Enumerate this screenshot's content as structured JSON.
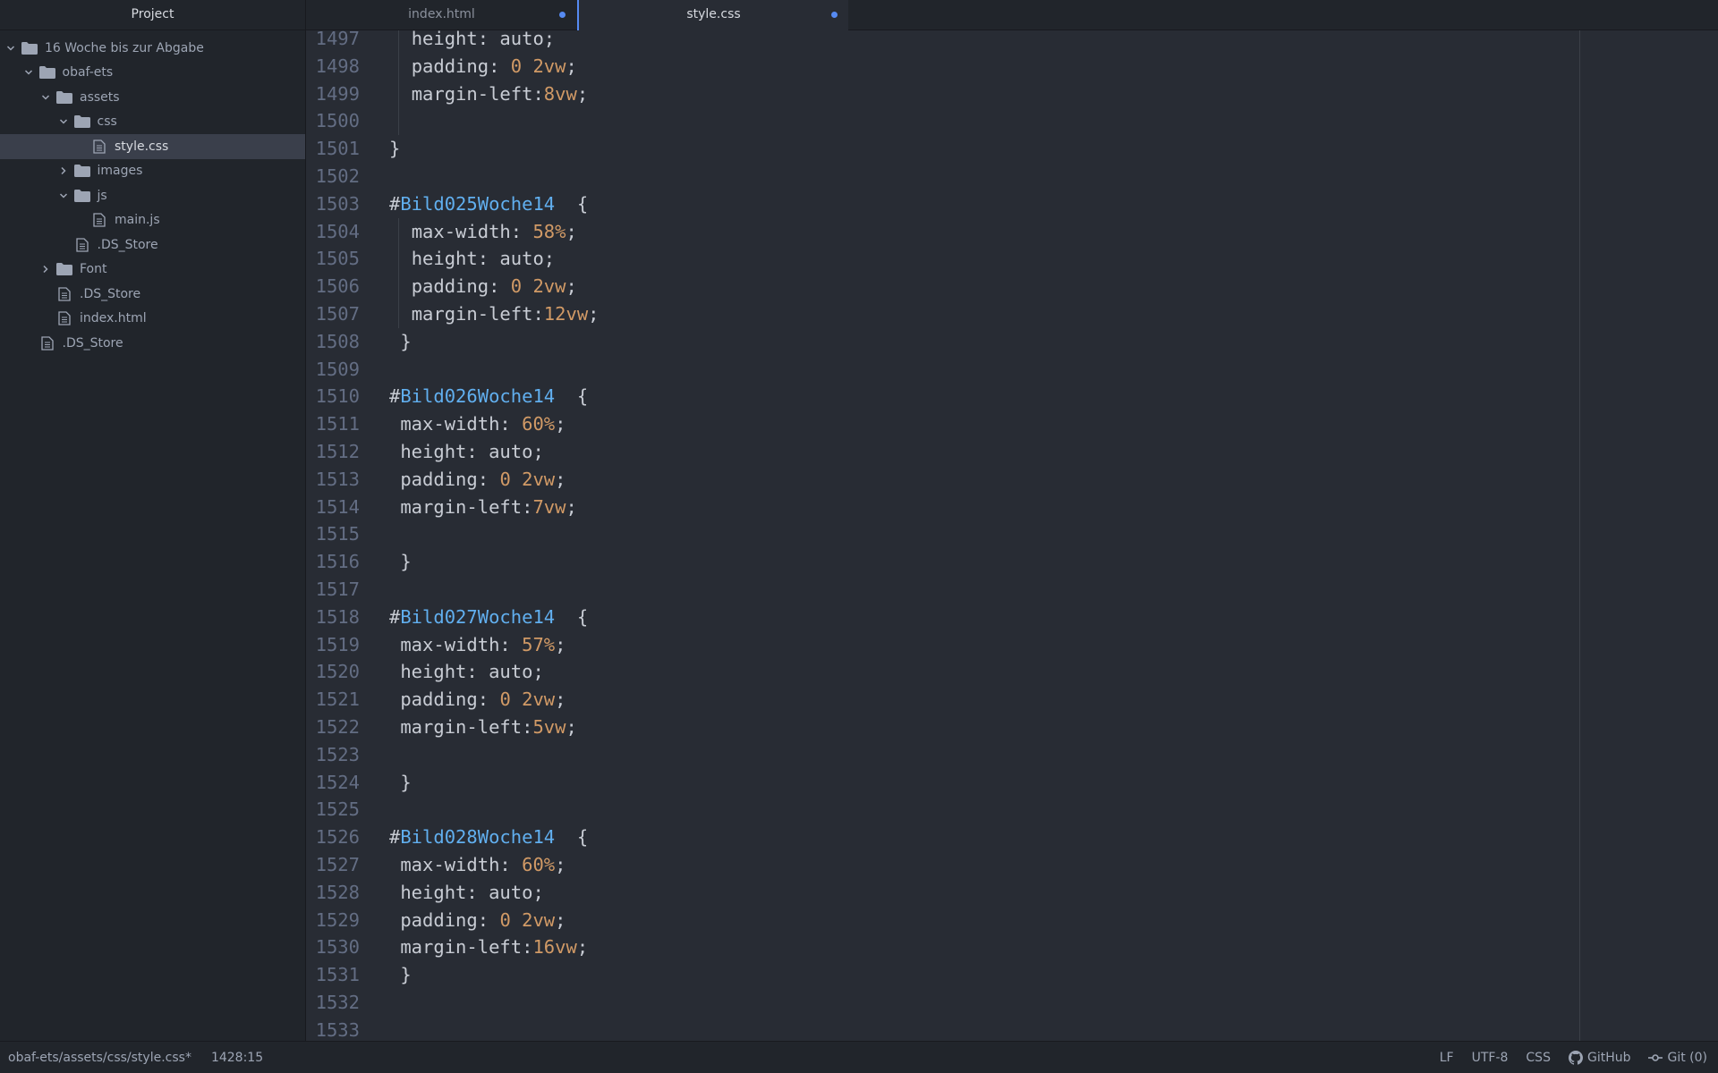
{
  "sidebar": {
    "title": "Project",
    "tree": [
      {
        "label": "16 Woche bis zur Abgabe",
        "type": "folder",
        "expanded": true,
        "depth": 0
      },
      {
        "label": "obaf-ets",
        "type": "folder",
        "expanded": true,
        "depth": 1
      },
      {
        "label": "assets",
        "type": "folder",
        "expanded": true,
        "depth": 2
      },
      {
        "label": "css",
        "type": "folder",
        "expanded": true,
        "depth": 3
      },
      {
        "label": "style.css",
        "type": "file",
        "depth": 4,
        "selected": true
      },
      {
        "label": "images",
        "type": "folder",
        "expanded": false,
        "depth": 3
      },
      {
        "label": "js",
        "type": "folder",
        "expanded": true,
        "depth": 3
      },
      {
        "label": "main.js",
        "type": "file",
        "depth": 4
      },
      {
        "label": ".DS_Store",
        "type": "file",
        "depth": 3
      },
      {
        "label": "Font",
        "type": "folder",
        "expanded": false,
        "depth": 2
      },
      {
        "label": ".DS_Store",
        "type": "file",
        "depth": 2
      },
      {
        "label": "index.html",
        "type": "file",
        "depth": 2
      },
      {
        "label": ".DS_Store",
        "type": "file",
        "depth": 1
      }
    ]
  },
  "tabs": [
    {
      "label": "index.html",
      "active": false,
      "modified": true
    },
    {
      "label": "style.css",
      "active": true,
      "modified": true
    }
  ],
  "editor": {
    "lines": [
      {
        "n": "1497",
        "indent": "  ",
        "parts": [
          [
            "p",
            "height: auto;"
          ]
        ],
        "guide": true
      },
      {
        "n": "1498",
        "indent": "  ",
        "parts": [
          [
            "p",
            "padding: "
          ],
          [
            "n",
            "0 2vw"
          ],
          [
            "p",
            ";"
          ]
        ],
        "guide": true
      },
      {
        "n": "1499",
        "indent": "  ",
        "parts": [
          [
            "p",
            "margin-left:"
          ],
          [
            "n",
            "8vw"
          ],
          [
            "p",
            ";"
          ]
        ],
        "guide": true
      },
      {
        "n": "1500",
        "indent": "",
        "parts": [],
        "guide": true
      },
      {
        "n": "1501",
        "indent": "",
        "parts": [
          [
            "p",
            "}"
          ]
        ]
      },
      {
        "n": "1502",
        "indent": "",
        "parts": []
      },
      {
        "n": "1503",
        "indent": "",
        "parts": [
          [
            "h",
            "#"
          ],
          [
            "i",
            "Bild025Woche14"
          ],
          [
            "p",
            "  {"
          ]
        ]
      },
      {
        "n": "1504",
        "indent": "  ",
        "parts": [
          [
            "p",
            "max-width: "
          ],
          [
            "n",
            "58%"
          ],
          [
            "p",
            ";"
          ]
        ],
        "guide": true
      },
      {
        "n": "1505",
        "indent": "  ",
        "parts": [
          [
            "p",
            "height: auto;"
          ]
        ],
        "guide": true
      },
      {
        "n": "1506",
        "indent": "  ",
        "parts": [
          [
            "p",
            "padding: "
          ],
          [
            "n",
            "0 2vw"
          ],
          [
            "p",
            ";"
          ]
        ],
        "guide": true
      },
      {
        "n": "1507",
        "indent": "  ",
        "parts": [
          [
            "p",
            "margin-left:"
          ],
          [
            "n",
            "12vw"
          ],
          [
            "p",
            ";"
          ]
        ],
        "guide": true
      },
      {
        "n": "1508",
        "indent": " ",
        "parts": [
          [
            "p",
            "}"
          ]
        ]
      },
      {
        "n": "1509",
        "indent": "",
        "parts": []
      },
      {
        "n": "1510",
        "indent": "",
        "parts": [
          [
            "h",
            "#"
          ],
          [
            "i",
            "Bild026Woche14"
          ],
          [
            "p",
            "  {"
          ]
        ]
      },
      {
        "n": "1511",
        "indent": " ",
        "parts": [
          [
            "p",
            "max-width: "
          ],
          [
            "n",
            "60%"
          ],
          [
            "p",
            ";"
          ]
        ]
      },
      {
        "n": "1512",
        "indent": " ",
        "parts": [
          [
            "p",
            "height: auto;"
          ]
        ]
      },
      {
        "n": "1513",
        "indent": " ",
        "parts": [
          [
            "p",
            "padding: "
          ],
          [
            "n",
            "0 2vw"
          ],
          [
            "p",
            ";"
          ]
        ]
      },
      {
        "n": "1514",
        "indent": " ",
        "parts": [
          [
            "p",
            "margin-left:"
          ],
          [
            "n",
            "7vw"
          ],
          [
            "p",
            ";"
          ]
        ]
      },
      {
        "n": "1515",
        "indent": "",
        "parts": []
      },
      {
        "n": "1516",
        "indent": " ",
        "parts": [
          [
            "p",
            "}"
          ]
        ]
      },
      {
        "n": "1517",
        "indent": "",
        "parts": []
      },
      {
        "n": "1518",
        "indent": "",
        "parts": [
          [
            "h",
            "#"
          ],
          [
            "i",
            "Bild027Woche14"
          ],
          [
            "p",
            "  {"
          ]
        ]
      },
      {
        "n": "1519",
        "indent": " ",
        "parts": [
          [
            "p",
            "max-width: "
          ],
          [
            "n",
            "57%"
          ],
          [
            "p",
            ";"
          ]
        ]
      },
      {
        "n": "1520",
        "indent": " ",
        "parts": [
          [
            "p",
            "height: auto;"
          ]
        ]
      },
      {
        "n": "1521",
        "indent": " ",
        "parts": [
          [
            "p",
            "padding: "
          ],
          [
            "n",
            "0 2vw"
          ],
          [
            "p",
            ";"
          ]
        ]
      },
      {
        "n": "1522",
        "indent": " ",
        "parts": [
          [
            "p",
            "margin-left:"
          ],
          [
            "n",
            "5vw"
          ],
          [
            "p",
            ";"
          ]
        ]
      },
      {
        "n": "1523",
        "indent": "",
        "parts": []
      },
      {
        "n": "1524",
        "indent": " ",
        "parts": [
          [
            "p",
            "}"
          ]
        ]
      },
      {
        "n": "1525",
        "indent": "",
        "parts": []
      },
      {
        "n": "1526",
        "indent": "",
        "parts": [
          [
            "h",
            "#"
          ],
          [
            "i",
            "Bild028Woche14"
          ],
          [
            "p",
            "  {"
          ]
        ]
      },
      {
        "n": "1527",
        "indent": " ",
        "parts": [
          [
            "p",
            "max-width: "
          ],
          [
            "n",
            "60%"
          ],
          [
            "p",
            ";"
          ]
        ]
      },
      {
        "n": "1528",
        "indent": " ",
        "parts": [
          [
            "p",
            "height: auto;"
          ]
        ]
      },
      {
        "n": "1529",
        "indent": " ",
        "parts": [
          [
            "p",
            "padding: "
          ],
          [
            "n",
            "0 2vw"
          ],
          [
            "p",
            ";"
          ]
        ]
      },
      {
        "n": "1530",
        "indent": " ",
        "parts": [
          [
            "p",
            "margin-left:"
          ],
          [
            "n",
            "16vw"
          ],
          [
            "p",
            ";"
          ]
        ]
      },
      {
        "n": "1531",
        "indent": " ",
        "parts": [
          [
            "p",
            "}"
          ]
        ]
      },
      {
        "n": "1532",
        "indent": "",
        "parts": []
      },
      {
        "n": "1533",
        "indent": "",
        "parts": []
      }
    ]
  },
  "status": {
    "path": "obaf-ets/assets/css/style.css*",
    "cursor": "1428:15",
    "line_ending": "LF",
    "encoding": "UTF-8",
    "grammar": "CSS",
    "github": "GitHub",
    "git": "Git (0)"
  },
  "colors": {
    "accent": "#568af2",
    "selector_id": "#61afef",
    "number": "#d19a66"
  }
}
